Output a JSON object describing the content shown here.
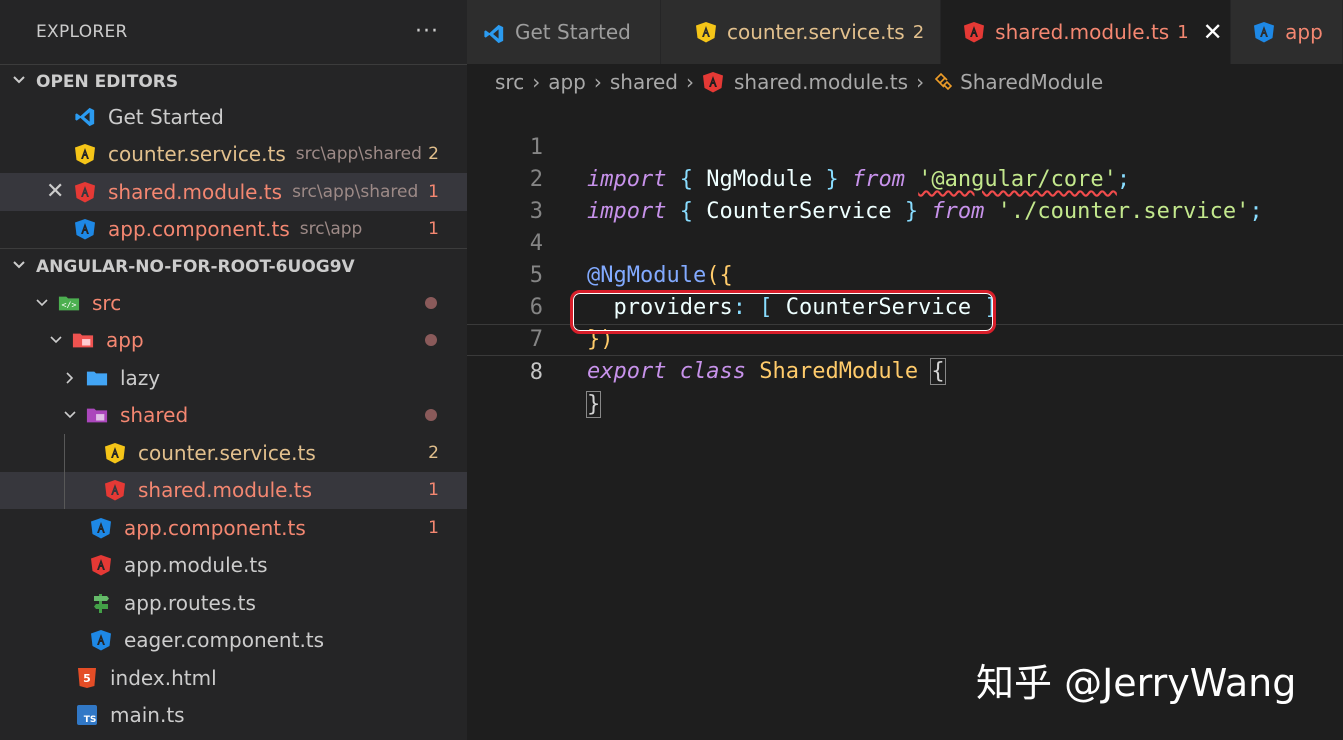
{
  "explorer": {
    "title": "EXPLORER",
    "more_label": "···",
    "open_editors_title": "OPEN EDITORS",
    "open_editors": [
      {
        "name": "Get Started",
        "path": "",
        "badge": "",
        "icon": "vscode-icon"
      },
      {
        "name": "counter.service.ts",
        "path": "src\\app\\shared",
        "badge": "2",
        "icon": "angular-service-icon"
      },
      {
        "name": "shared.module.ts",
        "path": "src\\app\\shared",
        "badge": "1",
        "icon": "angular-module-icon"
      },
      {
        "name": "app.component.ts",
        "path": "src\\app",
        "badge": "1",
        "icon": "angular-component-icon"
      }
    ],
    "close_glyph": "✕",
    "project_title": "ANGULAR-NO-FOR-ROOT-6UOG9V",
    "tree": [
      {
        "name": "src",
        "icon": "src-folder-icon"
      },
      {
        "name": "app",
        "icon": "app-folder-icon"
      },
      {
        "name": "lazy",
        "icon": "folder-icon"
      },
      {
        "name": "shared",
        "icon": "shared-folder-icon"
      },
      {
        "name": "counter.service.ts",
        "badge": "2",
        "icon": "angular-service-icon"
      },
      {
        "name": "shared.module.ts",
        "badge": "1",
        "icon": "angular-module-icon"
      },
      {
        "name": "app.component.ts",
        "badge": "1",
        "icon": "angular-component-icon"
      },
      {
        "name": "app.module.ts",
        "icon": "angular-module-icon"
      },
      {
        "name": "app.routes.ts",
        "icon": "routes-icon"
      },
      {
        "name": "eager.component.ts",
        "icon": "angular-component-icon"
      },
      {
        "name": "index.html",
        "icon": "html5-icon"
      },
      {
        "name": "main.ts",
        "icon": "typescript-icon"
      }
    ]
  },
  "tabs": [
    {
      "label": "Get Started",
      "num": ""
    },
    {
      "label": "counter.service.ts",
      "num": "2"
    },
    {
      "label": "shared.module.ts",
      "num": "1",
      "close": "✕"
    },
    {
      "label": "app"
    }
  ],
  "breadcrumb": [
    "src",
    "app",
    "shared",
    "shared.module.ts",
    "SharedModule"
  ],
  "breadcrumb_sep": "›",
  "editor": {
    "line_numbers": [
      "1",
      "2",
      "3",
      "4",
      "5",
      "6",
      "7",
      "8"
    ],
    "lines": {
      "l1": [
        "import",
        " { ",
        "NgModule",
        " } ",
        "from",
        " ",
        "'@angular/core'",
        ";"
      ],
      "l2": [
        "import",
        " { ",
        "CounterService",
        " } ",
        "from",
        " ",
        "'./counter.service'",
        ";"
      ],
      "l4": [
        "@NgModule",
        "({"
      ],
      "l5": [
        "  providers",
        ": ",
        "[ ",
        "CounterService",
        " ]"
      ],
      "l6": [
        "})"
      ],
      "l7": [
        "export",
        " ",
        "class",
        " ",
        "SharedModule",
        " ",
        "{"
      ],
      "l8": [
        "}"
      ]
    }
  },
  "watermark": "知乎 @JerryWang",
  "colors": {
    "error": "#f48771",
    "warning": "#e2c08d",
    "highlight_box": "#d81e2a"
  }
}
